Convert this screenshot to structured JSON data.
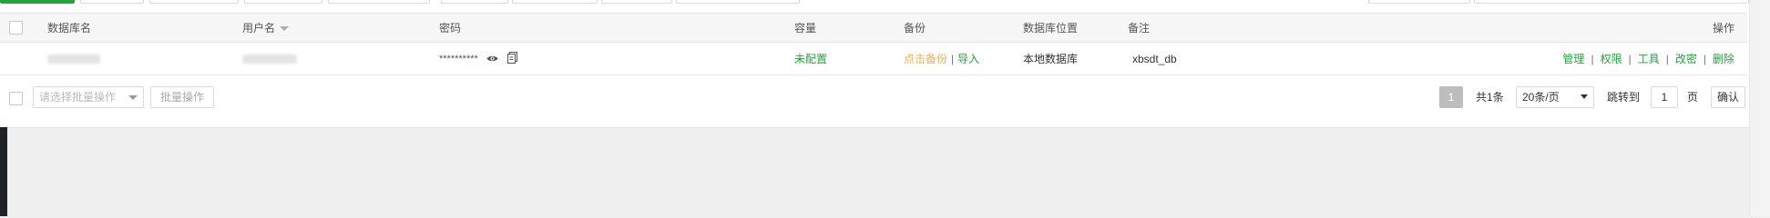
{
  "table": {
    "headers": {
      "name": "数据库名",
      "username": "用户名",
      "password": "密码",
      "capacity": "容量",
      "backup": "备份",
      "location": "数据库位置",
      "remark": "备注",
      "actions": "操作"
    },
    "rows": [
      {
        "password": "**********",
        "capacity": "未配置",
        "backup_link": "点击备份",
        "backup_separator": "|",
        "import_link": "导入",
        "location": "本地数据库",
        "remark": "xbsdt_db",
        "actions": [
          "管理",
          "权限",
          "工具",
          "改密",
          "删除"
        ],
        "action_separator": "|"
      }
    ]
  },
  "toolbar": {
    "batch_select_placeholder": "请选择批量操作",
    "batch_button": "批量操作"
  },
  "pagination": {
    "current_page": "1",
    "total": "共1条",
    "page_size": "20条/页",
    "jump_label": "跳转到",
    "jump_value": "1",
    "page_unit": "页",
    "confirm": "确认"
  },
  "colors": {
    "accent_green": "#20a53a",
    "backup_orange": "#f0ad4e",
    "sidebar_dark": "#1f2327"
  }
}
